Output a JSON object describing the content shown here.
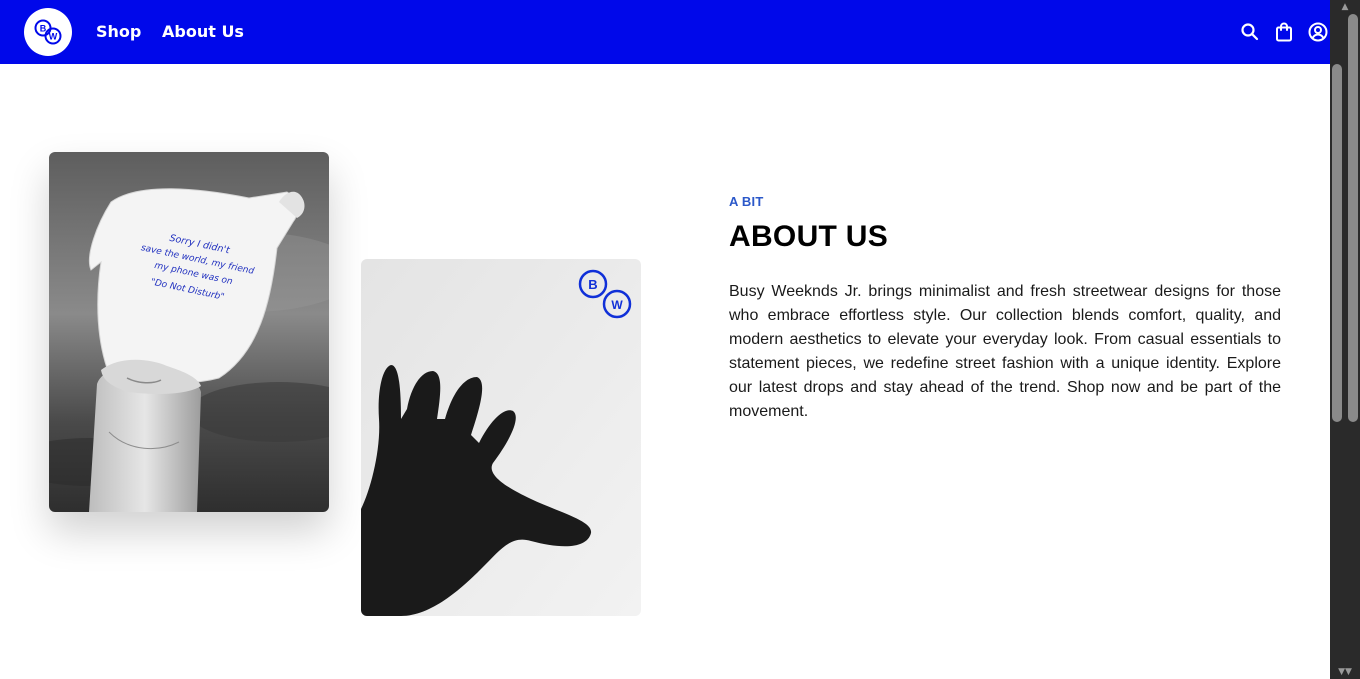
{
  "header": {
    "logo_letters": [
      "B",
      "W"
    ],
    "nav": [
      {
        "label": "Shop"
      },
      {
        "label": "About Us"
      }
    ],
    "icons": [
      "search-icon",
      "shopping-bag-icon",
      "user-account-icon"
    ],
    "background": "#0008ea"
  },
  "about": {
    "eyebrow": "A BIT",
    "title": "ABOUT US",
    "body": "Busy Weeknds Jr. brings minimalist and fresh streetwear designs for those who embrace effortless style. Our collection blends comfort, quality, and modern aesthetics to elevate your everyday look. From casual essentials to statement pieces, we redefine street fashion with a unique identity. Explore our latest drops and stay ahead of the trend. Shop now and be part of the movement."
  },
  "images": {
    "shirt_photo": {
      "shirt_text": [
        "Sorry I didn't",
        "save the world, my friend",
        "my phone was on",
        "\"Do Not Disturb\""
      ]
    },
    "hand_photo": {
      "logo_letters": [
        "B",
        "W"
      ]
    }
  },
  "colors": {
    "accent": "#2b58c9",
    "brand_blue": "#0008ea"
  }
}
